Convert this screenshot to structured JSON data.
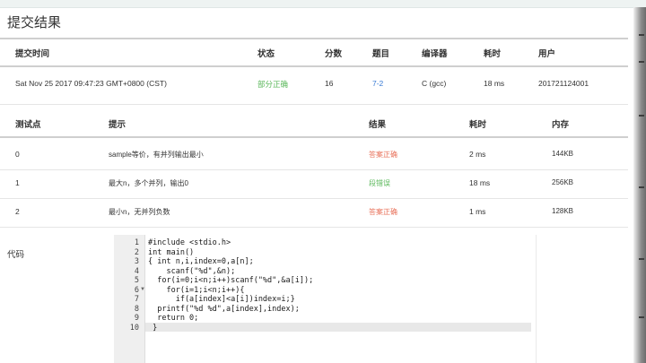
{
  "page": {
    "title": "提交结果"
  },
  "submission": {
    "headers": {
      "time": "提交时间",
      "status": "状态",
      "score": "分数",
      "problem": "题目",
      "compiler": "编译器",
      "elapsed": "耗时",
      "user": "用户"
    },
    "row": {
      "time": "Sat Nov 25 2017 09:47:23 GMT+0800 (CST)",
      "status": "部分正确",
      "score": "16",
      "problem": "7-2",
      "compiler": "C (gcc)",
      "elapsed": "18 ms",
      "user": "201721124001"
    }
  },
  "tests": {
    "headers": {
      "id": "测试点",
      "hint": "提示",
      "result": "结果",
      "elapsed": "耗时",
      "memory": "内存"
    },
    "rows": [
      {
        "id": "0",
        "hint": "sample等价，有并列输出最小",
        "result": "答案正确",
        "elapsed": "2 ms",
        "memory": "144KB"
      },
      {
        "id": "1",
        "hint": "最大n，多个并列，输出0",
        "result": "段错误",
        "elapsed": "18 ms",
        "memory": "256KB"
      },
      {
        "id": "2",
        "hint": "最小n，无并列负数",
        "result": "答案正确",
        "elapsed": "1 ms",
        "memory": "128KB"
      }
    ]
  },
  "code": {
    "label": "代码",
    "lines": [
      "#include <stdio.h>",
      "int main()",
      "{ int n,i,index=0,a[n];",
      "    scanf(\"%d\",&n);",
      "  for(i=0;i<n;i++)scanf(\"%d\",&a[i]);",
      "    for(i=1;i<n;i++){",
      "      if(a[index]<a[i])index=i;}",
      "  printf(\"%d %d\",a[index],index);",
      "  return 0;",
      " }"
    ],
    "line_numbers": [
      "1",
      "2",
      "3",
      "4",
      "5",
      "6",
      "7",
      "8",
      "9",
      "10"
    ]
  },
  "colors": {
    "accepted": "#5cb85c",
    "error": "#e8715a",
    "link": "#3a7bd5"
  }
}
